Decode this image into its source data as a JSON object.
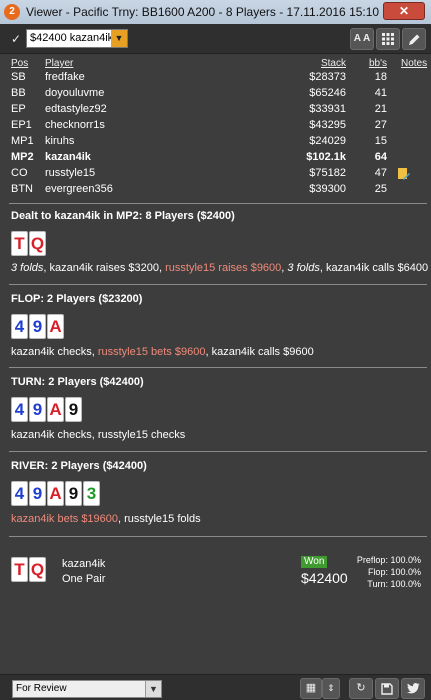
{
  "window": {
    "badge": "2",
    "title": "Viewer - Pacific Trny: BB1600 A200 - 8 Players - 17.11.2016 15:10",
    "close_label": "✕"
  },
  "toolbar": {
    "hand_select_value": "$42400 kazan4ik",
    "font_button_label": "A A"
  },
  "players_table": {
    "headers": {
      "pos": "Pos",
      "player": "Player",
      "stack": "Stack",
      "bbs": "bb's",
      "notes": "Notes"
    },
    "rows": [
      {
        "pos": "SB",
        "name": "fredfake",
        "stack": "$28373",
        "bbs": "18"
      },
      {
        "pos": "BB",
        "name": "doyouluvme",
        "stack": "$65246",
        "bbs": "41"
      },
      {
        "pos": "EP",
        "name": "edtastylez92",
        "stack": "$33931",
        "bbs": "21"
      },
      {
        "pos": "EP1",
        "name": "checknorr1s",
        "stack": "$43295",
        "bbs": "27"
      },
      {
        "pos": "MP1",
        "name": "kiruhs",
        "stack": "$24029",
        "bbs": "15"
      },
      {
        "pos": "MP2",
        "name": "kazan4ik",
        "stack": "$102.1k",
        "bbs": "64",
        "hero": true
      },
      {
        "pos": "CO",
        "name": "russtyle15",
        "stack": "$75182",
        "bbs": "47",
        "note_icon": "note-icon"
      },
      {
        "pos": "BTN",
        "name": "evergreen356",
        "stack": "$39300",
        "bbs": "25"
      }
    ]
  },
  "preflop": {
    "title": "Dealt to kazan4ik in MP2: 8 Players ($2400)",
    "cards": [
      {
        "rank": "T",
        "color": "#d8202a"
      },
      {
        "rank": "Q",
        "color": "#d8202a"
      }
    ],
    "actions": {
      "a1": "3 folds",
      "a2": ", kazan4ik raises $3200, ",
      "a3": "russtyle15 raises $9600",
      "a4": ", ",
      "a5": "3 folds",
      "a6": ", kazan4ik calls $6400"
    }
  },
  "flop": {
    "title": "FLOP: 2 Players ($23200)",
    "cards": [
      {
        "rank": "4",
        "color": "#1f3fd0"
      },
      {
        "rank": "9",
        "color": "#1f3fd0"
      },
      {
        "rank": "A",
        "color": "#d8202a"
      }
    ],
    "actions": {
      "a1": "kazan4ik checks, ",
      "a2": "russtyle15 bets $9600",
      "a3": ", kazan4ik calls $9600"
    }
  },
  "turn": {
    "title": "TURN: 2 Players ($42400)",
    "cards": [
      {
        "rank": "4",
        "color": "#1f3fd0"
      },
      {
        "rank": "9",
        "color": "#1f3fd0"
      },
      {
        "rank": "A",
        "color": "#d8202a"
      },
      {
        "rank": "9",
        "color": "#111111"
      }
    ],
    "actions": {
      "a1": "kazan4ik checks, russtyle15 checks"
    }
  },
  "river": {
    "title": "RIVER: 2 Players ($42400)",
    "cards": [
      {
        "rank": "4",
        "color": "#1f3fd0"
      },
      {
        "rank": "9",
        "color": "#1f3fd0"
      },
      {
        "rank": "A",
        "color": "#d8202a"
      },
      {
        "rank": "9",
        "color": "#111111"
      },
      {
        "rank": "3",
        "color": "#1f9a2a"
      }
    ],
    "actions": {
      "a1": "kazan4ik bets $19600",
      "a2": ", russtyle15 folds"
    }
  },
  "result": {
    "cards": [
      {
        "rank": "T",
        "color": "#d8202a"
      },
      {
        "rank": "Q",
        "color": "#d8202a"
      }
    ],
    "player": "kazan4ik",
    "hand": "One Pair",
    "badge": "Won",
    "amount": "$42400",
    "stats": [
      {
        "label": "Preflop:",
        "value": "100.0%"
      },
      {
        "label": "Flop:",
        "value": "100.0%"
      },
      {
        "label": "Turn:",
        "value": "100.0%"
      }
    ]
  },
  "bottombar": {
    "review_select_value": "For Review"
  },
  "colors": {
    "highlight": "#f08a7a",
    "won_badge": "#3f9a2f",
    "dropdown_accent": "#e8a022"
  }
}
